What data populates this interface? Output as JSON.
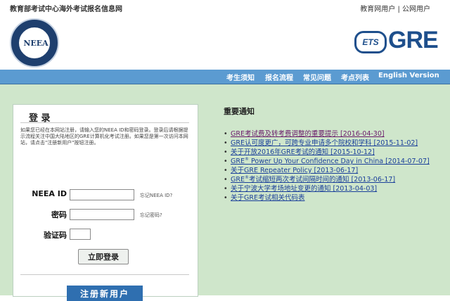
{
  "header": {
    "site_title": "教育部考试中心海外考试报名信息网",
    "user_links": {
      "neea_user": "教育网用户",
      "separator": " | ",
      "public_user": "公网用户"
    },
    "neea_logo_text": "NEEA",
    "ets_text": "ETS",
    "gre_text": "GRE"
  },
  "nav": {
    "items": [
      "考生须知",
      "报名流程",
      "常见问题",
      "考点列表",
      "English Version"
    ]
  },
  "login": {
    "title": "登 录",
    "description": "如果您已经在本网站注册，请输入您的NEEA ID和密码登录。登录后请根据提示流程关注中国大陆地区的GRE计算机化考试注册。如果您是第一次访问本网站，请点击\"注册新用户\"按钮注册。",
    "neea_id_label": "NEEA ID",
    "neea_id_value": "",
    "forgot_id": "忘记NEEA ID?",
    "password_label": "密码",
    "password_value": "",
    "forgot_password": "忘记密码?",
    "captcha_label": "验证码",
    "captcha_value": "",
    "login_button": "立即登录",
    "register_button": "注册新用户"
  },
  "notices": {
    "title": "重要通知",
    "items": [
      {
        "text": "GRE考试费及转考费调整的重要提示 [2016-04-30]",
        "visited": true
      },
      {
        "text": "GRE认可度更广，可跨专业申请多个院校和学科 [2015-11-02]",
        "visited": false
      },
      {
        "text": "关于开放2016年GRE考试的通知 [2015-10-12]",
        "visited": false
      },
      {
        "pre": "GRE",
        "sup": "®",
        "text": " Power Up Your Confidence Day in China [2014-07-07]",
        "visited": false
      },
      {
        "text": "关于GRE Repeater Policy [2013-06-17]",
        "visited": false
      },
      {
        "pre": "GRE",
        "sup": "®",
        "text": "考试缩短两次考试间隔时间的通知 [2013-06-17]",
        "visited": false
      },
      {
        "text": "关于宁波大学考场地址变更的通知 [2013-04-03]",
        "visited": false
      },
      {
        "text": "关于GRE考试相关代码表",
        "visited": false
      }
    ]
  },
  "colors": {
    "nav_bg": "#5b9bd1",
    "main_bg": "#cfe6cb",
    "register_bg": "#2f6fb0",
    "link": "#1a3f9a"
  }
}
